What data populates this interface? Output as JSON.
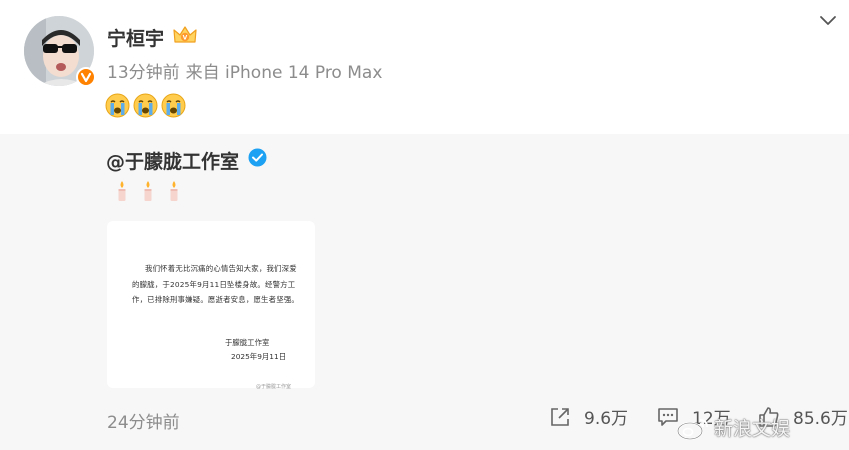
{
  "post": {
    "author": "宁桓宇",
    "time": "13分钟前",
    "source": "来自 iPhone 14 Pro Max",
    "emojis": [
      "crying-face-emoji",
      "crying-face-emoji",
      "crying-face-emoji"
    ]
  },
  "repost": {
    "mention": "@于朦胧工作室",
    "candles": [
      "candle-emoji",
      "candle-emoji",
      "candle-emoji"
    ],
    "notice_image": {
      "body": "我们怀着无比沉痛的心情告知大家，我们深爱的朦胧，于2025年9月11日坠楼身故。经警方工作，已排除刑事嫌疑。愿逝者安息，愿生者坚强。",
      "signature": "于朦胧工作室",
      "date": "2025年9月11日",
      "watermark": "@于朦胧工作室"
    },
    "time": "24分钟前",
    "stats": {
      "reposts": "9.6万",
      "comments": "12万",
      "likes": "85.6万"
    }
  },
  "watermark": "新浪文娱",
  "colors": {
    "verified_orange": "#ff8200",
    "verified_blue": "#1da1f2",
    "repost_bg": "#f7f7f7",
    "meta_text": "#8c8c8c"
  }
}
